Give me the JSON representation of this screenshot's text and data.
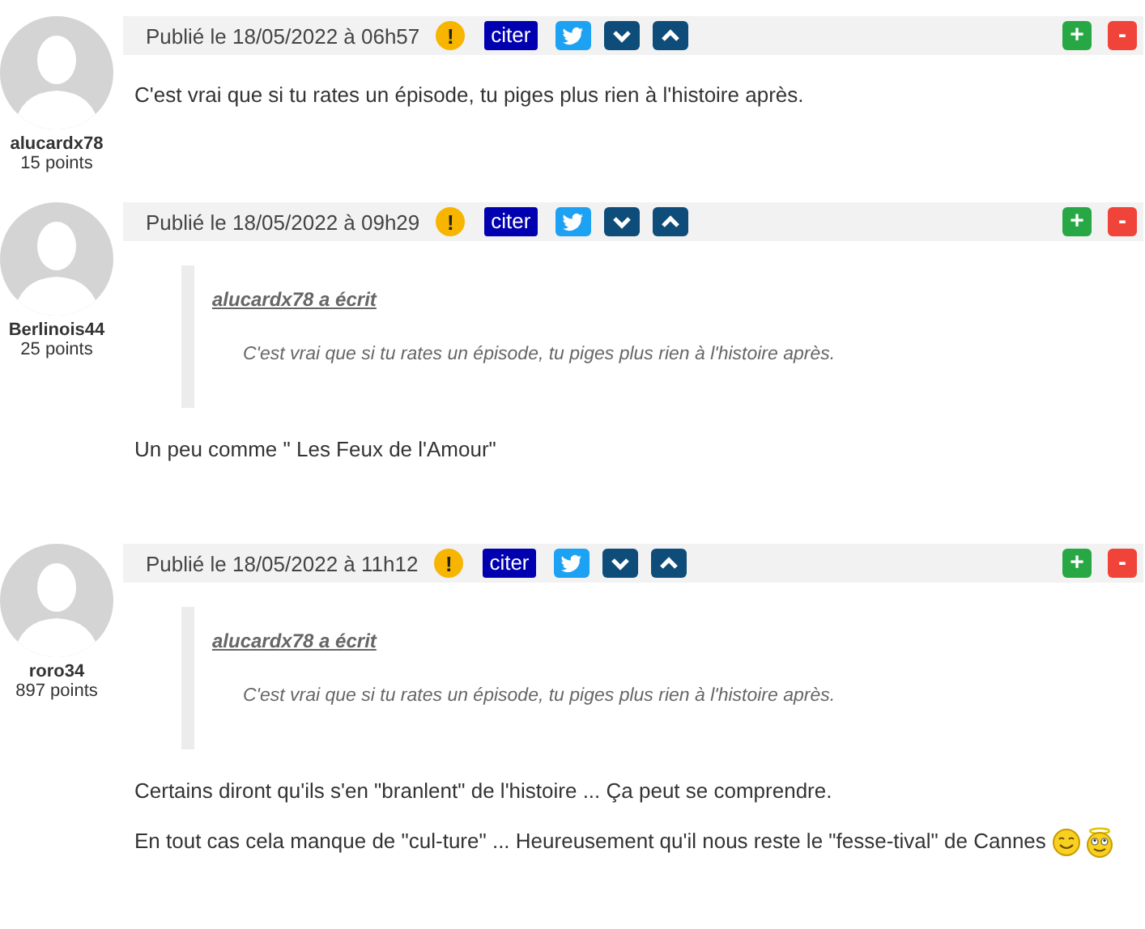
{
  "posts": [
    {
      "author": "alucardx78",
      "points": "15 points",
      "date": "Publié le 18/05/2022 à 06h57",
      "actions": [
        {
          "kind": "report",
          "label": "!"
        },
        {
          "kind": "quote",
          "label": "citer"
        },
        {
          "kind": "twitter"
        },
        {
          "kind": "down"
        },
        {
          "kind": "up"
        }
      ],
      "votes": [
        {
          "kind": "plus",
          "label": "+"
        },
        {
          "kind": "minus",
          "label": "-"
        }
      ],
      "paragraphs": [
        {
          "text": "C'est vrai que si tu rates un épisode, tu piges plus rien à l'histoire après."
        }
      ]
    },
    {
      "author": "Berlinois44",
      "points": "25 points",
      "date": "Publié le 18/05/2022 à 09h29",
      "actions": [
        {
          "kind": "report",
          "label": "!"
        },
        {
          "kind": "quote",
          "label": "citer"
        },
        {
          "kind": "twitter"
        },
        {
          "kind": "down"
        },
        {
          "kind": "up"
        }
      ],
      "votes": [
        {
          "kind": "plus",
          "label": "+"
        },
        {
          "kind": "minus",
          "label": "-"
        }
      ],
      "quote": {
        "author_line": "alucardx78 a écrit",
        "text": "C'est vrai que si tu rates un épisode, tu piges plus rien à l'histoire après."
      },
      "paragraphs": [
        {
          "text": "Un peu comme  \" Les Feux de l'Amour\""
        }
      ]
    },
    {
      "author": "roro34",
      "points": "897 points",
      "date": "Publié le 18/05/2022 à 11h12",
      "actions": [
        {
          "kind": "report",
          "label": "!"
        },
        {
          "kind": "quote",
          "label": "citer"
        },
        {
          "kind": "twitter"
        },
        {
          "kind": "down"
        },
        {
          "kind": "up"
        }
      ],
      "votes": [
        {
          "kind": "plus",
          "label": "+"
        },
        {
          "kind": "minus",
          "label": "-"
        }
      ],
      "quote": {
        "author_line": "alucardx78 a écrit",
        "text": "C'est vrai que si tu rates un épisode, tu piges plus rien à l'histoire après."
      },
      "paragraphs": [
        {
          "text": "Certains diront qu'ils s'en \"branlent\" de l'histoire ... Ça peut se comprendre."
        },
        {
          "text": "En tout cas cela manque de \"cul-ture\" ... Heureusement qu'il nous reste le \"fesse-tival\" de Cannes",
          "smileys": [
            {
              "kind": "smile"
            },
            {
              "kind": "halo"
            }
          ]
        }
      ]
    }
  ]
}
